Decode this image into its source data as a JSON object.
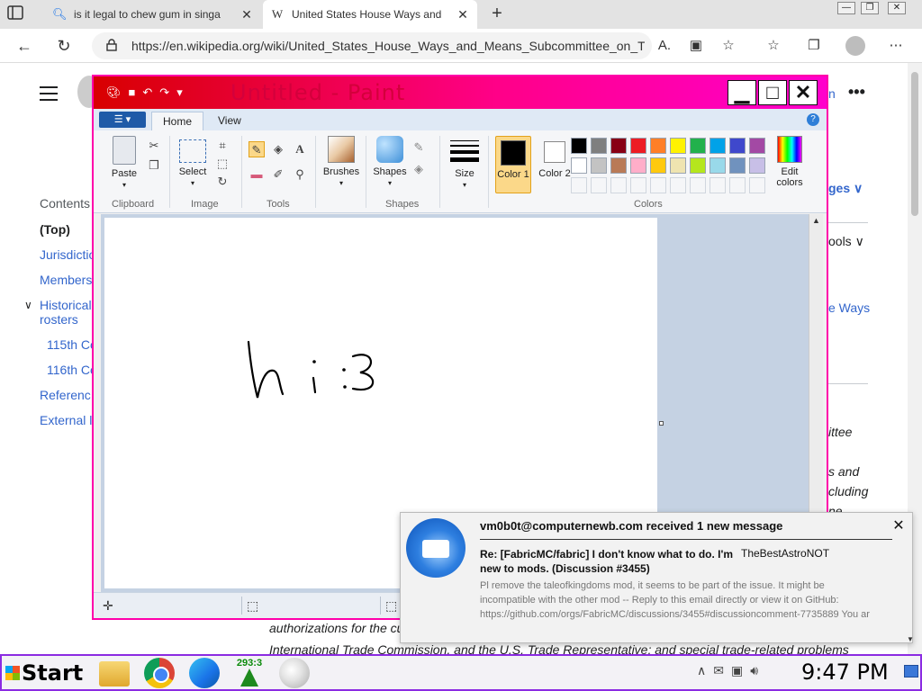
{
  "browser": {
    "tabs": [
      {
        "title": "is it legal to chew gum in singa",
        "favicon": "search-icon"
      },
      {
        "title": "United States House Ways and",
        "favicon": "W"
      }
    ],
    "url": "https://en.wikipedia.org/wiki/United_States_House_Ways_and_Means_Subcommittee_on_Tr..."
  },
  "wiki": {
    "toc_title": "Contents",
    "toc_items": [
      "(Top)",
      "Jurisdictio",
      "Members",
      "Historical rosters",
      "115th Co",
      "116th Co",
      "Referenc",
      "External l"
    ],
    "right_fragments": [
      "n",
      "ges",
      "ools",
      "e Ways",
      "ittee",
      "s and",
      "cluding",
      "ne"
    ],
    "body_lines": [
      "authorizations for the cu",
      "International Trade Commission, and the U.S. Trade Representative; and special trade-related problems"
    ]
  },
  "paint": {
    "title": "Untitled - Paint",
    "tabs": [
      "Home",
      "View"
    ],
    "groups": {
      "clipboard": "Clipboard",
      "image": "Image",
      "tools": "Tools",
      "shapes": "Shapes",
      "colors": "Colors"
    },
    "buttons": {
      "paste": "Paste",
      "select": "Select",
      "brushes": "Brushes",
      "shapes": "Shapes",
      "size": "Size",
      "color1": "Color 1",
      "color2": "Color 2",
      "edit_colors": "Edit colors"
    },
    "palette_row1": [
      "#000000",
      "#7f7f7f",
      "#880015",
      "#ed1c24",
      "#ff7f27",
      "#fff200",
      "#22b14c",
      "#00a2e8",
      "#3f48cc",
      "#a349a4"
    ],
    "palette_row2": [
      "#ffffff",
      "#c3c3c3",
      "#b97a57",
      "#ffaec9",
      "#ffc90e",
      "#efe4b0",
      "#b5e61d",
      "#99d9ea",
      "#7092be",
      "#c8bfe7"
    ],
    "canvas_text": "hi :3"
  },
  "notification": {
    "account": "vm0b0t@computernewb.com received 1 new message",
    "subject": "Re: [FabricMC/fabric] I don't know what to do. I'm new to mods. (Discussion #3455)",
    "sender": "TheBestAstroNOT",
    "preview": "Pl remove the taleofkingdoms mod, it seems to be part of the issue. It might be incompatible with the other mod -- Reply to this email directly or view it on GitHub: https://github.com/orgs/FabricMC/discussions/3455#discussioncomment-7735889 You ar"
  },
  "taskbar": {
    "start_label": "Start",
    "tree_count": "293:3",
    "clock": "9:47 PM"
  },
  "colors": {
    "taskbar_border": "#8b2be2",
    "paint_title_gradient_start": "#d80000",
    "paint_title_gradient_end": "#ff00cc",
    "wiki_link": "#3366cc"
  }
}
